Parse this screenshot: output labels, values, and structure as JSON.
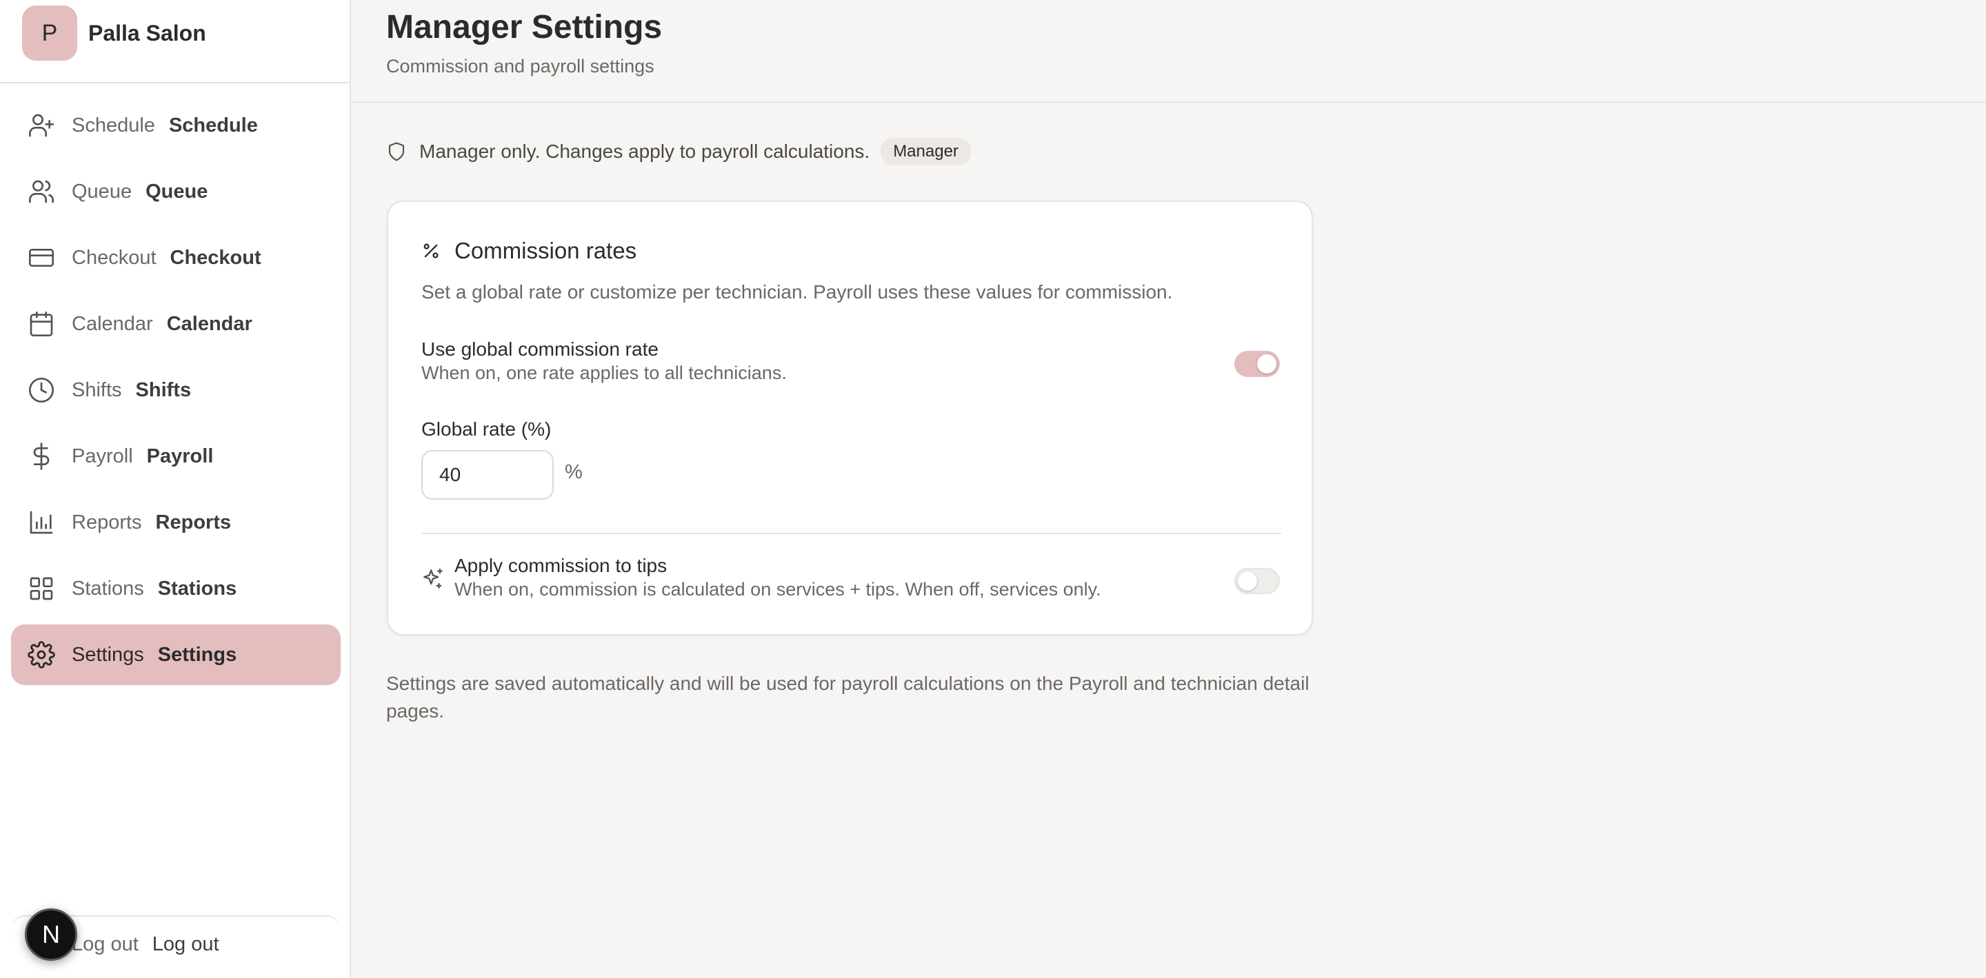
{
  "brand": {
    "initial": "P",
    "name": "Palla Salon"
  },
  "nav": {
    "items": [
      {
        "label": "Schedule",
        "label2": "Schedule",
        "icon": "user-plus-icon"
      },
      {
        "label": "Queue",
        "label2": "Queue",
        "icon": "users-icon"
      },
      {
        "label": "Checkout",
        "label2": "Checkout",
        "icon": "credit-card-icon"
      },
      {
        "label": "Calendar",
        "label2": "Calendar",
        "icon": "calendar-icon"
      },
      {
        "label": "Shifts",
        "label2": "Shifts",
        "icon": "clock-icon"
      },
      {
        "label": "Payroll",
        "label2": "Payroll",
        "icon": "dollar-icon"
      },
      {
        "label": "Reports",
        "label2": "Reports",
        "icon": "bar-chart-icon"
      },
      {
        "label": "Stations",
        "label2": "Stations",
        "icon": "grid-icon"
      },
      {
        "label": "Settings",
        "label2": "Settings",
        "icon": "gear-icon",
        "active": true
      }
    ],
    "logout": {
      "label": "Log out",
      "label2": "Log out",
      "icon": "logout-icon"
    }
  },
  "dev_badge": {
    "letter": "N"
  },
  "header": {
    "title": "Manager Settings",
    "subtitle": "Commission and payroll settings"
  },
  "notice": {
    "text": "Manager only. Changes apply to payroll calculations.",
    "badge": "Manager"
  },
  "card": {
    "title": "Commission rates",
    "description": "Set a global rate or customize per technician. Payroll uses these values for commission.",
    "global_toggle": {
      "label": "Use global commission rate",
      "sub": "When on, one rate applies to all technicians.",
      "on": true
    },
    "global_rate": {
      "label": "Global rate (%)",
      "value": "40",
      "unit": "%"
    },
    "tips_toggle": {
      "label": "Apply commission to tips",
      "sub": "When on, commission is calculated on services + tips. When off, services only.",
      "on": false
    }
  },
  "footnote": "Settings are saved automatically and will be used for payroll calculations on the Payroll and technician detail pages.",
  "colors": {
    "accent": "#e4bdbe",
    "background": "#f6f5f3",
    "sidebar": "#ffffff"
  }
}
